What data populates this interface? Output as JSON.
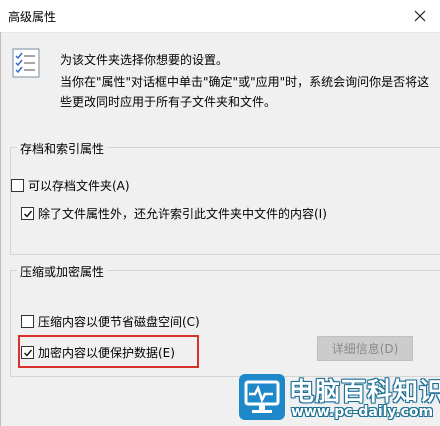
{
  "dialog": {
    "title": "高级属性",
    "close_icon": "close-icon"
  },
  "intro": {
    "icon": "properties-list-icon",
    "line1": "为该文件夹选择你想要的设置。",
    "line2": "当你在\"属性\"对话框中单击\"确定\"或\"应用\"时，系统会询问你是否将这些更改同时应用于所有子文件夹和文件。"
  },
  "archive_group": {
    "label": "存档和索引属性",
    "options": [
      {
        "label": "可以存档文件夹(A)",
        "checked": false
      },
      {
        "label": "除了文件属性外，还允许索引此文件夹中文件的内容(I)",
        "checked": true
      }
    ]
  },
  "compress_group": {
    "label": "压缩或加密属性",
    "options": [
      {
        "label": "压缩内容以便节省磁盘空间(C)",
        "checked": false
      },
      {
        "label": "加密内容以便保护数据(E)",
        "checked": true
      }
    ],
    "details_button": "详细信息(D)",
    "details_enabled": false
  },
  "highlight_color": "#d9322c",
  "watermark": {
    "title": "电脑百科知识",
    "url": "www.pc-daily.com"
  }
}
